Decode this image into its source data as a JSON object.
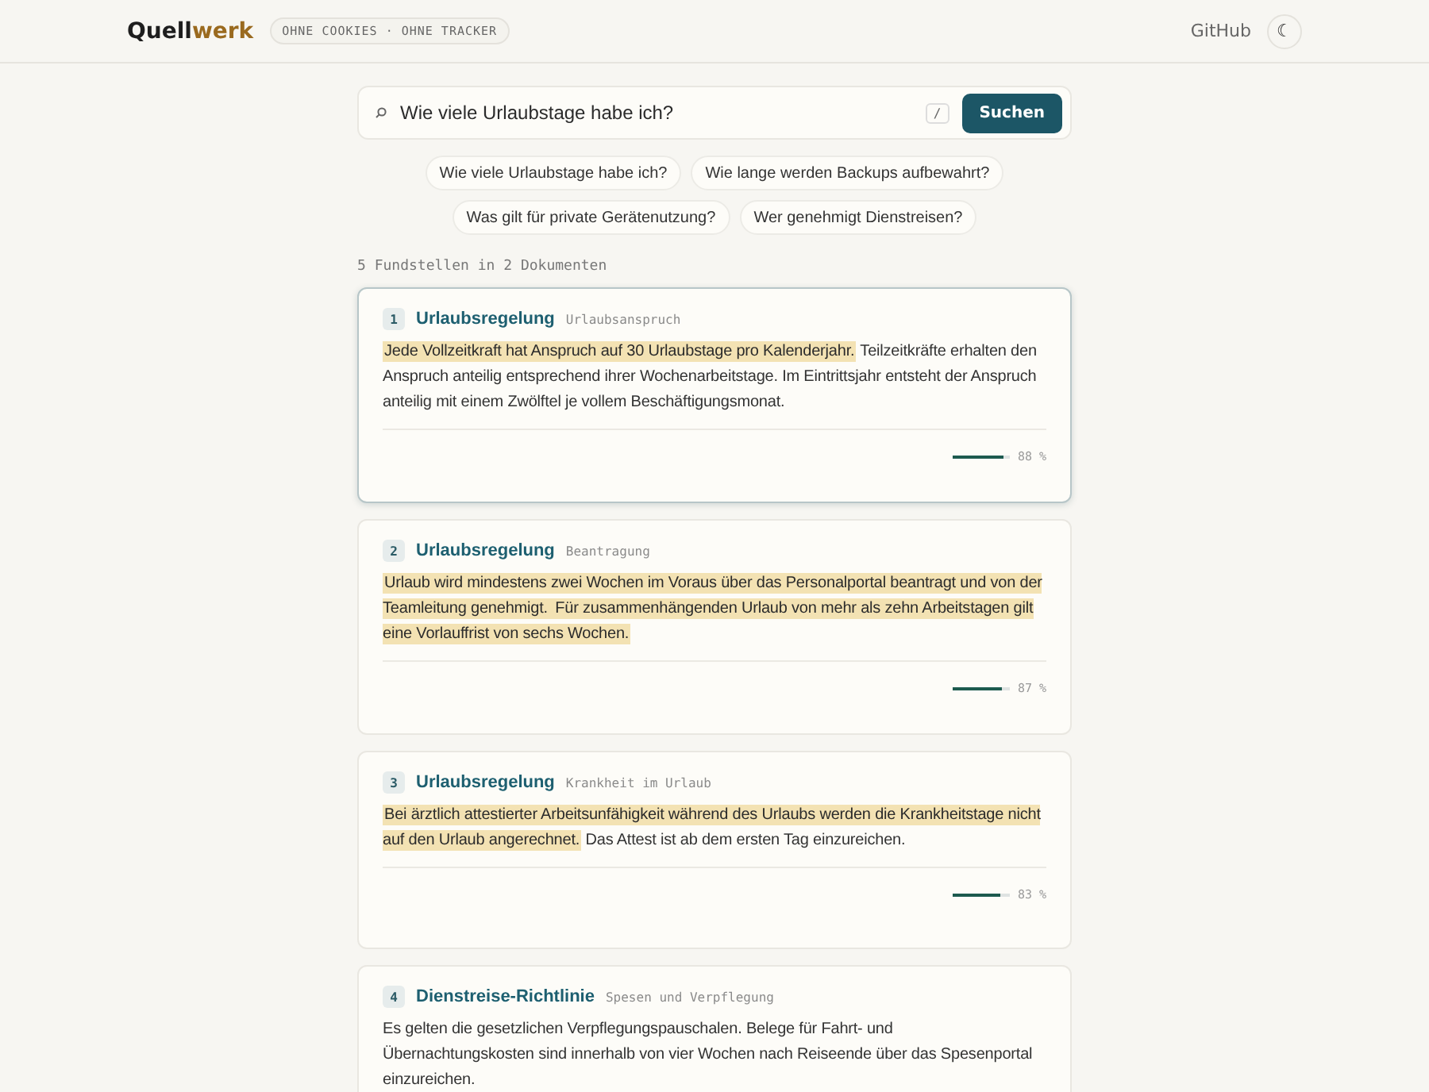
{
  "header": {
    "logo": {
      "part_1": "Quell",
      "part_2": "werk"
    },
    "badge": "OHNE COOKIES · OHNE TRACKER",
    "link": "GitHub",
    "theme_toggle": "☾"
  },
  "search": {
    "value": "Wie viele Urlaubstage habe ich?",
    "shortcut": "/",
    "button": "Suchen"
  },
  "suggestions": [
    "Wie viele Urlaubstage habe ich?",
    "Wie lange werden Backups aufbewahrt?",
    "Was gilt für private Gerätenutzung?",
    "Wer genehmigt Dienstreisen?"
  ],
  "summary": "5 Fundstellen in 2 Dokumenten",
  "results": [
    {
      "number": "1",
      "document": "Urlaubsregelung",
      "section": "Urlaubsanspruch",
      "selected": true,
      "segments": [
        {
          "text": "Jede Vollzeitkraft hat Anspruch auf 30 Urlaubstage pro Kalenderjahr.",
          "highlight": true
        },
        {
          "text": " Teilzeitkräfte erhalten den Anspruch anteilig entsprechend ihrer Wochenarbeitstage. Im Eintrittsjahr entsteht der Anspruch anteilig mit einem Zwölftel je vollem Beschäftigungsmonat.",
          "highlight": false
        }
      ],
      "level": 0.88,
      "score": "88 %"
    },
    {
      "number": "2",
      "document": "Urlaubsregelung",
      "section": "Beantragung",
      "selected": false,
      "segments": [
        {
          "text": "Urlaub wird mindestens zwei Wochen im Voraus über das Personalportal beantragt und von der Teamleitung genehmigt. ",
          "highlight": true
        },
        {
          "text": "Für zusammenhängenden Urlaub von mehr als zehn Arbeitstagen gilt eine Vorlauffrist von sechs Wochen.",
          "highlight": true
        }
      ],
      "level": 0.87,
      "score": "87 %"
    },
    {
      "number": "3",
      "document": "Urlaubsregelung",
      "section": "Krankheit im Urlaub",
      "selected": false,
      "segments": [
        {
          "text": "Bei ärztlich attestierter Arbeitsunfähigkeit während des Urlaubs werden die Krankheitstage nicht auf den Urlaub angerechnet.",
          "highlight": true
        },
        {
          "text": " Das Attest ist ab dem ersten Tag einzureichen.",
          "highlight": false
        }
      ],
      "level": 0.83,
      "score": "83 %"
    },
    {
      "number": "4",
      "document": "Dienstreise-Richtlinie",
      "section": "Spesen und Verpflegung",
      "selected": false,
      "segments": [
        {
          "text": "Es gelten die gesetzlichen Verpflegungspauschalen. Belege für Fahrt- und Übernachtungskosten sind innerhalb von vier Wochen nach Reiseende über das Spesenportal einzureichen.",
          "highlight": false
        }
      ]
    }
  ]
}
